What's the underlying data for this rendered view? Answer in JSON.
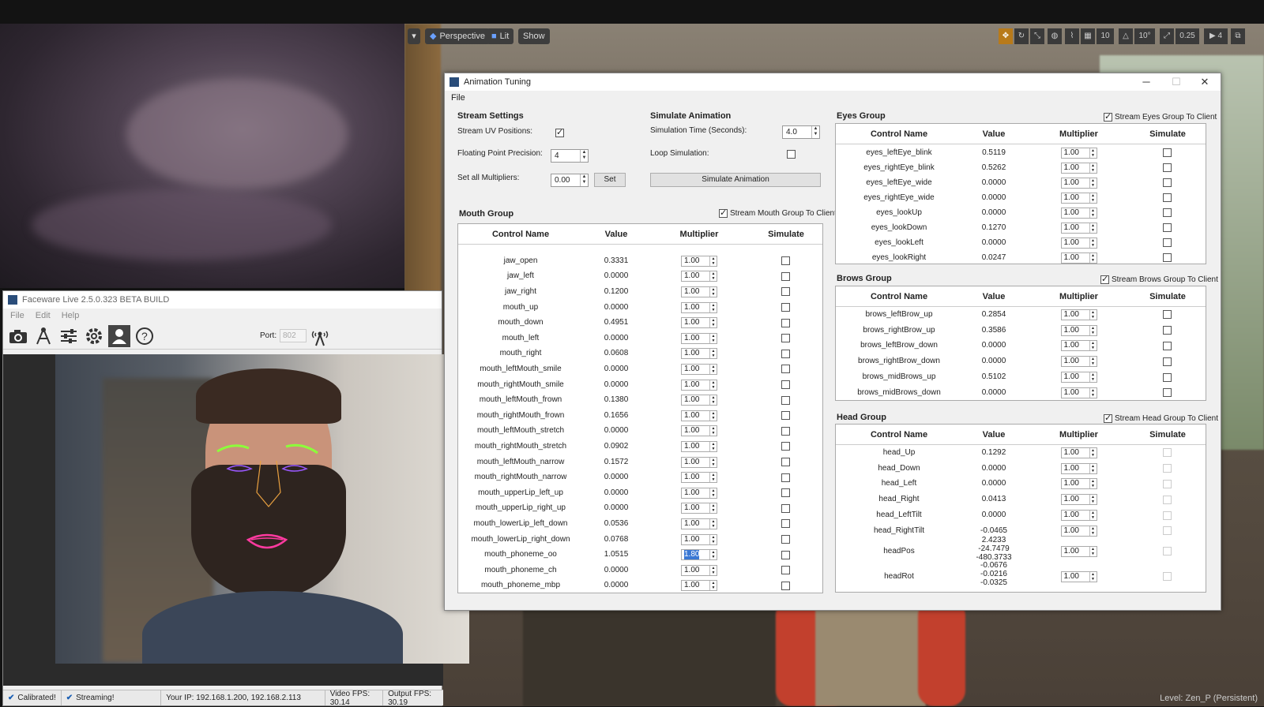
{
  "ue_viewport": {
    "perspective_label": "Perspective",
    "lit_label": "Lit",
    "show_label": "Show",
    "grid_snap": "10",
    "rot_snap": "10°",
    "scale_snap": "0.25",
    "cam_speed": "4",
    "level_label": "Level:  Zen_P (Persistent)"
  },
  "faceware": {
    "title": "Faceware Live 2.5.0.323 BETA BUILD",
    "menu": [
      "File",
      "Edit",
      "Help"
    ],
    "port_label": "Port:",
    "port_value": "802",
    "status": {
      "calibrated": "Calibrated!",
      "streaming": "Streaming!",
      "ip": "Your IP: 192.168.1.200, 192.168.2.113",
      "video_fps": "Video FPS: 30.14",
      "output_fps": "Output FPS: 30.19"
    }
  },
  "anim": {
    "title": "Animation Tuning",
    "menu_file": "File",
    "stream_settings": {
      "heading": "Stream Settings",
      "uv_label": "Stream UV Positions:",
      "uv_checked": true,
      "precision_label": "Floating Point Precision:",
      "precision_value": "4",
      "multipliers_label": "Set all Multipliers:",
      "multipliers_value": "0.00",
      "set_button": "Set"
    },
    "simulate": {
      "heading": "Simulate Animation",
      "time_label": "Simulation Time (Seconds):",
      "time_value": "4.0",
      "loop_label": "Loop Simulation:",
      "loop_checked": false,
      "button": "Simulate Animation"
    },
    "columns": {
      "name": "Control Name",
      "value": "Value",
      "mult": "Multiplier",
      "sim": "Simulate"
    },
    "mouth": {
      "title": "Mouth Group",
      "stream": "Stream Mouth Group To Client",
      "rows": [
        {
          "name": "jaw_open",
          "value": "0.3331",
          "mult": "1.00"
        },
        {
          "name": "jaw_left",
          "value": "0.0000",
          "mult": "1.00"
        },
        {
          "name": "jaw_right",
          "value": "0.1200",
          "mult": "1.00"
        },
        {
          "name": "mouth_up",
          "value": "0.0000",
          "mult": "1.00"
        },
        {
          "name": "mouth_down",
          "value": "0.4951",
          "mult": "1.00"
        },
        {
          "name": "mouth_left",
          "value": "0.0000",
          "mult": "1.00"
        },
        {
          "name": "mouth_right",
          "value": "0.0608",
          "mult": "1.00"
        },
        {
          "name": "mouth_leftMouth_smile",
          "value": "0.0000",
          "mult": "1.00"
        },
        {
          "name": "mouth_rightMouth_smile",
          "value": "0.0000",
          "mult": "1.00"
        },
        {
          "name": "mouth_leftMouth_frown",
          "value": "0.1380",
          "mult": "1.00"
        },
        {
          "name": "mouth_rightMouth_frown",
          "value": "0.1656",
          "mult": "1.00"
        },
        {
          "name": "mouth_leftMouth_stretch",
          "value": "0.0000",
          "mult": "1.00"
        },
        {
          "name": "mouth_rightMouth_stretch",
          "value": "0.0902",
          "mult": "1.00"
        },
        {
          "name": "mouth_leftMouth_narrow",
          "value": "0.1572",
          "mult": "1.00"
        },
        {
          "name": "mouth_rightMouth_narrow",
          "value": "0.0000",
          "mult": "1.00"
        },
        {
          "name": "mouth_upperLip_left_up",
          "value": "0.0000",
          "mult": "1.00"
        },
        {
          "name": "mouth_upperLip_right_up",
          "value": "0.0000",
          "mult": "1.00"
        },
        {
          "name": "mouth_lowerLip_left_down",
          "value": "0.0536",
          "mult": "1.00"
        },
        {
          "name": "mouth_lowerLip_right_down",
          "value": "0.0768",
          "mult": "1.00"
        },
        {
          "name": "mouth_phoneme_oo",
          "value": "1.0515",
          "mult": "1.80"
        },
        {
          "name": "mouth_phoneme_ch",
          "value": "0.0000",
          "mult": "1.00"
        },
        {
          "name": "mouth_phoneme_mbp",
          "value": "0.0000",
          "mult": "1.00"
        }
      ]
    },
    "eyes": {
      "title": "Eyes Group",
      "stream": "Stream Eyes Group To Client",
      "rows": [
        {
          "name": "eyes_leftEye_blink",
          "value": "0.5119",
          "mult": "1.00"
        },
        {
          "name": "eyes_rightEye_blink",
          "value": "0.5262",
          "mult": "1.00"
        },
        {
          "name": "eyes_leftEye_wide",
          "value": "0.0000",
          "mult": "1.00"
        },
        {
          "name": "eyes_rightEye_wide",
          "value": "0.0000",
          "mult": "1.00"
        },
        {
          "name": "eyes_lookUp",
          "value": "0.0000",
          "mult": "1.00"
        },
        {
          "name": "eyes_lookDown",
          "value": "0.1270",
          "mult": "1.00"
        },
        {
          "name": "eyes_lookLeft",
          "value": "0.0000",
          "mult": "1.00"
        },
        {
          "name": "eyes_lookRight",
          "value": "0.0247",
          "mult": "1.00"
        }
      ]
    },
    "brows": {
      "title": "Brows Group",
      "stream": "Stream Brows Group To Client",
      "rows": [
        {
          "name": "brows_leftBrow_up",
          "value": "0.2854",
          "mult": "1.00"
        },
        {
          "name": "brows_rightBrow_up",
          "value": "0.3586",
          "mult": "1.00"
        },
        {
          "name": "brows_leftBrow_down",
          "value": "0.0000",
          "mult": "1.00"
        },
        {
          "name": "brows_rightBrow_down",
          "value": "0.0000",
          "mult": "1.00"
        },
        {
          "name": "brows_midBrows_up",
          "value": "0.5102",
          "mult": "1.00"
        },
        {
          "name": "brows_midBrows_down",
          "value": "0.0000",
          "mult": "1.00"
        }
      ]
    },
    "head": {
      "title": "Head Group",
      "stream": "Stream Head Group To Client",
      "rows": [
        {
          "name": "head_Up",
          "value": "0.1292",
          "mult": "1.00"
        },
        {
          "name": "head_Down",
          "value": "0.0000",
          "mult": "1.00"
        },
        {
          "name": "head_Left",
          "value": "0.0000",
          "mult": "1.00"
        },
        {
          "name": "head_Right",
          "value": "0.0413",
          "mult": "1.00"
        },
        {
          "name": "head_LeftTilt",
          "value": "0.0000",
          "mult": "1.00"
        },
        {
          "name": "head_RightTilt",
          "value": "-0.0465",
          "mult": "1.00"
        },
        {
          "name": "headPos",
          "value": "2.4233\n-24.7479\n-480.3733",
          "mult": "1.00"
        },
        {
          "name": "headRot",
          "value": "-0.0676\n-0.0216\n-0.0325",
          "mult": "1.00"
        }
      ]
    }
  }
}
